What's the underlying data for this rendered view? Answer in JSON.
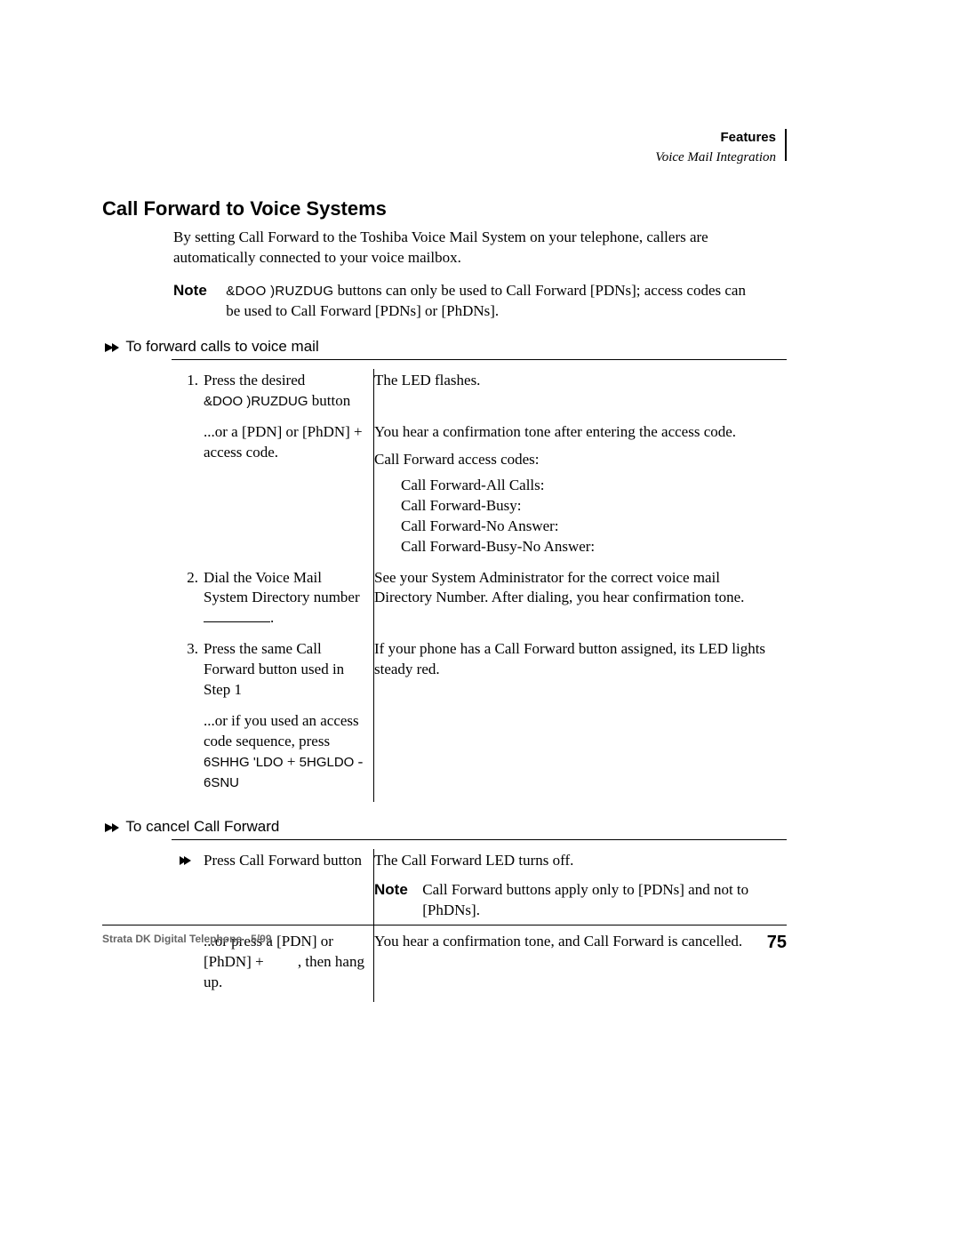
{
  "header": {
    "chapter": "Features",
    "section": "Voice Mail Integration"
  },
  "title": "Call Forward to Voice Systems",
  "intro": {
    "p1": "By setting Call Forward to the Toshiba Voice Mail System on your telephone, callers are automatically connected to your voice mailbox.",
    "note_label": "Note",
    "note_span1": "&DOO )RUZDUG",
    "note_span2": "buttons can only be used to Call Forward [PDNs]; access codes can be used to Call Forward [PDNs] or [PhDNs]."
  },
  "proc1": {
    "heading": "To forward calls to voice mail",
    "steps": [
      {
        "num": "1.",
        "action_a1": "Press the desired ",
        "action_a2": "&DOO )RUZDUG",
        "action_a3": " button",
        "result_a": "The LED flashes.",
        "action_b": "...or a [PDN] or [PhDN] + access code.",
        "result_b1": "You hear a confirmation tone after entering the access code.",
        "result_b2": "Call Forward access codes:",
        "codes": [
          "Call Forward-All Calls:",
          "Call Forward-Busy:",
          "Call Forward-No Answer:",
          "Call Forward-Busy-No Answer:"
        ]
      },
      {
        "num": "2.",
        "action_a": "Dial the Voice Mail System Directory number",
        "action_a_suffix": ".",
        "result": "See your System Administrator for the correct voice mail Directory Number. After dialing, you hear confirmation tone."
      },
      {
        "num": "3.",
        "action_a": "Press the same Call Forward button used in Step 1",
        "result_a": "If your phone has a Call Forward button assigned, its LED lights steady red.",
        "action_b1": "...or if you used an access code sequence, press ",
        "action_b2": "6SHHG 'LDO",
        "action_b3": " + ",
        "action_b4": "5HGLDO",
        "action_b5": " - ",
        "action_b6": "6SNU"
      }
    ]
  },
  "proc2": {
    "heading": "To cancel Call Forward",
    "steps": [
      {
        "action_a": "Press Call Forward button",
        "result_a": "The Call Forward LED turns off.",
        "note_label": "Note",
        "note_body": "Call Forward buttons apply only to [PDNs] and not to [PhDNs].",
        "action_b": "...or press a [PDN] or [PhDN] +         , then hang up.",
        "result_b": "You hear a confirmation tone, and Call Forward is cancelled."
      }
    ]
  },
  "footer": {
    "left": "Strata DK Digital Telephone   5/99",
    "page": "75"
  }
}
